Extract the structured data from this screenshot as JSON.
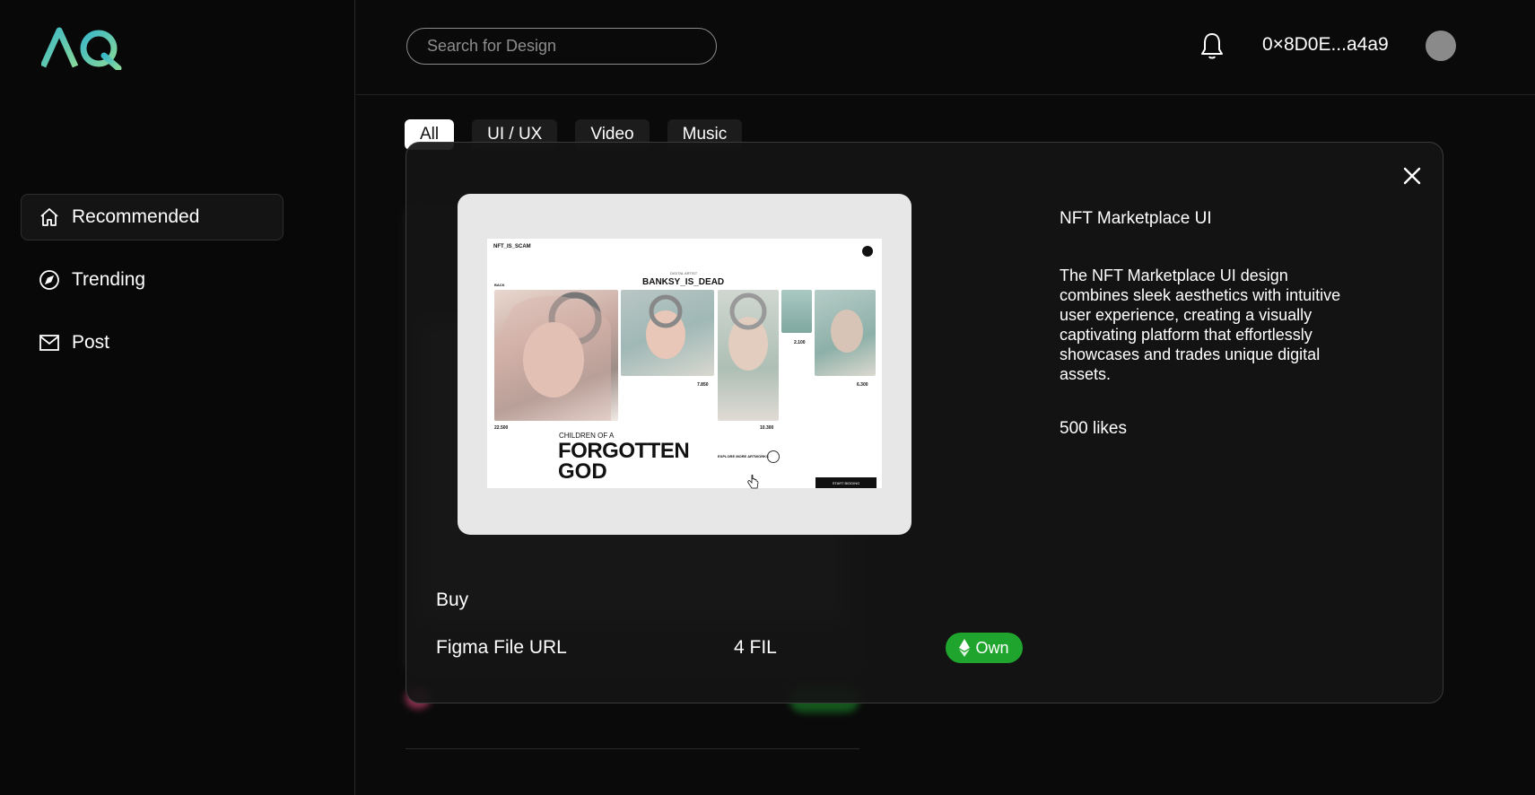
{
  "sidebar": {
    "logo_text": "AQ",
    "nav": [
      {
        "label": "Recommended",
        "icon": "home-icon",
        "active": true
      },
      {
        "label": "Trending",
        "icon": "compass-icon",
        "active": false
      },
      {
        "label": "Post",
        "icon": "mail-icon",
        "active": false
      }
    ]
  },
  "header": {
    "search_placeholder": "Search for Design",
    "wallet": "0×8D0E...a4a9",
    "icons": [
      "bell-icon",
      "avatar"
    ]
  },
  "tabs": [
    {
      "label": "All",
      "active": true
    },
    {
      "label": "UI / UX",
      "active": false
    },
    {
      "label": "Video",
      "active": false
    },
    {
      "label": "Music",
      "active": false
    }
  ],
  "modal": {
    "title": "NFT Marketplace UI",
    "description": "The NFT Marketplace UI design combines sleek aesthetics with intuitive user experience, creating a visually captivating platform that effortlessly showcases and trades unique digital assets.",
    "likes": "500 likes",
    "buy_label": "Buy",
    "file_label": "Figma File URL",
    "price": "4 FIL",
    "own_label": "Own",
    "preview": {
      "brand": "NFT_IS_SCAM",
      "artist_tag": "DIGITAL ARTIST",
      "artist": "BANKSY_IS_DEAD",
      "back": "BACK",
      "headline_small": "CHILDREN OF A",
      "headline_big_1": "FORGOTTEN",
      "headline_big_2": "GOD",
      "explore": "EXPLORE MORE ARTWORKS",
      "cta": "START BIDDING",
      "prices": [
        "22.500",
        "7.850",
        "2.100",
        "10.300",
        "6.300"
      ]
    }
  },
  "colors": {
    "accent_green": "#1fa52d",
    "logo_gradient": [
      "#4cc3c0",
      "#7ad3a0"
    ]
  }
}
